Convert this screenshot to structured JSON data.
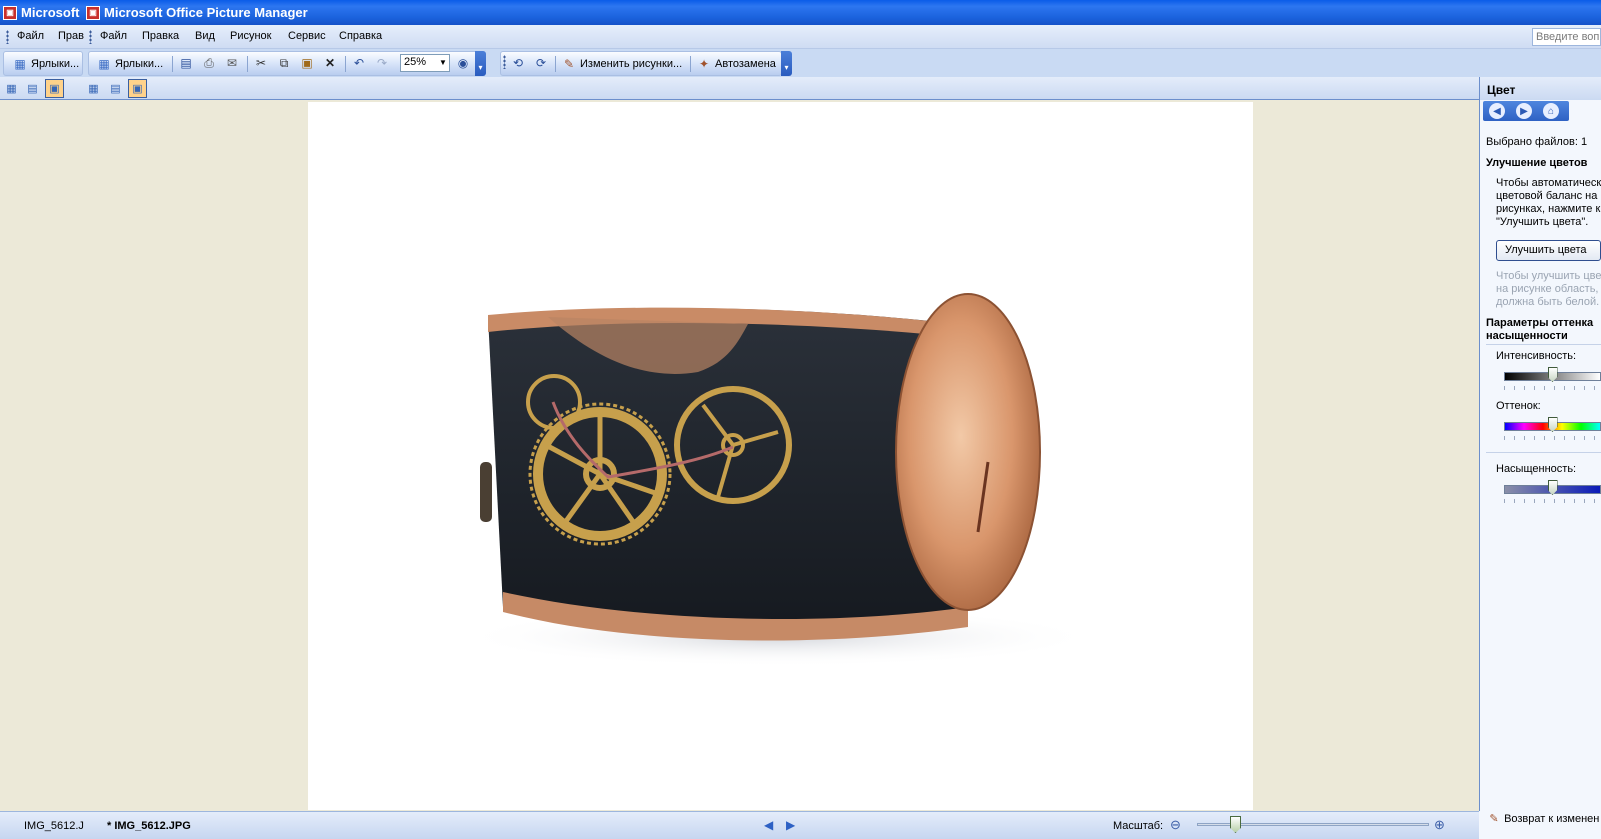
{
  "titlebar": {
    "left_title": "Microsoft",
    "main_title": "Microsoft Office Picture Manager"
  },
  "menubar": {
    "left_menu": [
      "Файл",
      "Прав"
    ],
    "menus": [
      "Файл",
      "Правка",
      "Вид",
      "Рисунок",
      "Сервис",
      "Справка"
    ],
    "help_placeholder": "Введите вопр"
  },
  "toolbar": {
    "shortcuts_left": "Ярлыки...",
    "shortcuts_right": "Ярлыки...",
    "zoom_value": "25%",
    "edit_pictures": "Изменить рисунки...",
    "autocorrect": "Автозамена"
  },
  "taskpane": {
    "title": "Цвет",
    "files_selected": "Выбрано файлов: 1",
    "enhance_heading": "Улучшение цветов",
    "enhance_desc": [
      "Чтобы автоматическ",
      "цветовой баланс на н",
      "рисунках, нажмите к",
      "\"Улучшить цвета\"."
    ],
    "enhance_button": "Улучшить цвета",
    "enhance_hint": [
      "Чтобы улучшить цве",
      "на рисунке область,",
      "должна быть белой."
    ],
    "params_heading": [
      "Параметры оттенка",
      "насыщенности"
    ],
    "intensity_label": "Интенсивность:",
    "hue_label": "Оттенок:",
    "saturation_label": "Насыщенность:",
    "intensity": 0.5,
    "hue": 0.5,
    "saturation": 0.5,
    "revert": "Возврат к изменен"
  },
  "statusbar": {
    "tabs": [
      "IMG_5612.J",
      "* IMG_5612.JPG"
    ],
    "zoom_label": "Масштаб:"
  },
  "colors": {
    "titlebar": "#1b62dd",
    "canvas": "#ece9d8",
    "accent": "#2e61c4"
  }
}
